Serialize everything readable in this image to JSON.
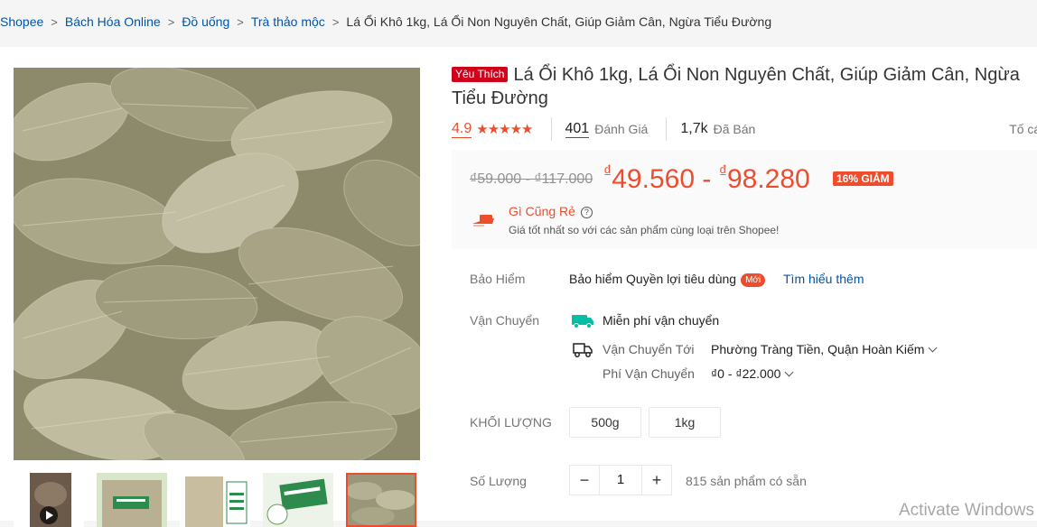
{
  "breadcrumb": {
    "items": [
      "Shopee",
      "Bách Hóa Online",
      "Đồ uống",
      "Trà thảo mộc"
    ],
    "current": "Lá Ổi Khô 1kg, Lá Ổi Non Nguyên Chất, Giúp Giảm Cân, Ngừa Tiểu Đường"
  },
  "product": {
    "badge": "Yêu Thích",
    "title": "Lá Ổi Khô 1kg, Lá Ổi Non Nguyên Chất, Giúp Giảm Cân, Ngừa Tiểu Đường",
    "rating": "4.9",
    "stars": "★★★★★",
    "review_count": "401",
    "review_label": "Đánh Giá",
    "sold_count": "1,7k",
    "sold_label": "Đã Bán",
    "report_label": "Tố cáo"
  },
  "price": {
    "original_range": "₫59.000 - ₫117.000",
    "currency": "₫",
    "min": "49.560",
    "separator": "-",
    "max": "98.280",
    "discount": "16% GIẢM",
    "cheap_title": "Gì Cũng Rẻ",
    "help_icon": "?",
    "cheap_sub": "Giá tốt nhất so với các sản phẩm cùng loại trên Shopee!"
  },
  "insurance": {
    "label": "Bảo Hiểm",
    "text": "Bảo hiểm Quyền lợi tiêu dùng",
    "badge": "Mới",
    "link": "Tìm hiểu thêm"
  },
  "shipping": {
    "label": "Vận Chuyển",
    "free": "Miễn phí vận chuyển",
    "to_label": "Vận Chuyển Tới",
    "to_value": "Phường Tràng Tiền, Quận Hoàn Kiếm",
    "fee_label": "Phí Vận Chuyển",
    "fee_value": "₫0 - ₫22.000"
  },
  "weight": {
    "label": "KHỐI LƯỢNG",
    "options": [
      "500g",
      "1kg"
    ]
  },
  "quantity": {
    "label": "Số Lượng",
    "minus": "−",
    "value": "1",
    "plus": "+",
    "stock": "815 sản phẩm có sẵn"
  },
  "watermark": "Activate Windows",
  "colors": {
    "accent": "#ee4d2d",
    "link": "#0055aa",
    "badge": "#d0011b"
  }
}
